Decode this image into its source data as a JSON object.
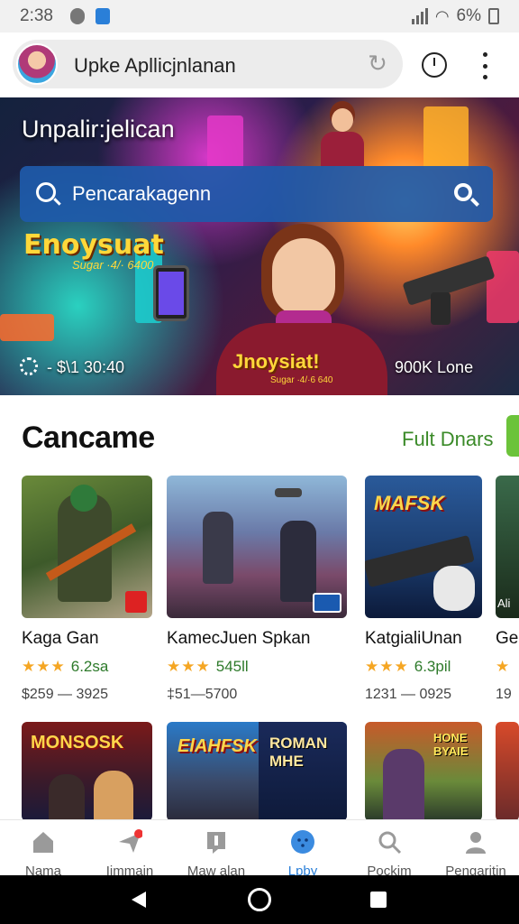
{
  "status_bar": {
    "time": "2:38",
    "battery": "6%"
  },
  "browser": {
    "url_text": "Upke Apllicjnlanan"
  },
  "hero": {
    "title": "Unpalir:jelican",
    "search_placeholder": "Pencarakagenn",
    "game_name": "Enoysuat",
    "game_sub": "Sugar ·4/· 6400",
    "meta_left": "- $\\1 30:40",
    "logo_text": "Jnoysiat!",
    "logo_sub": "Sugar ·4/·6 640",
    "meta_right": "900K Lone"
  },
  "section": {
    "title": "Cancame",
    "link": "Fult Dnars"
  },
  "cards": [
    {
      "title": "Kaga Gan",
      "rating": "6.2sa",
      "stars": 3,
      "price": "$259 — 3925",
      "badge": ""
    },
    {
      "title": "KamecJuen Spkan",
      "rating": "545ll",
      "stars": 3,
      "price": "‡51—5700",
      "badge": ""
    },
    {
      "title": "KatgialiUnan",
      "rating": "6.3pil",
      "stars": 3,
      "price": "1231 — 0925",
      "badge": "MAFSK"
    },
    {
      "title": "Ge",
      "rating": "",
      "stars": 1,
      "price": "19",
      "badge": "Ali"
    }
  ],
  "cards_row2": [
    {
      "badge": "MONSOSK"
    },
    {
      "badge": "ElAHFSK"
    },
    {
      "badge": "ROMAN MHE"
    },
    {
      "badge": "HONE BYAIE"
    }
  ],
  "bottom_nav": [
    {
      "label": "Nama",
      "icon": "home-icon"
    },
    {
      "label": "Ijmmain",
      "icon": "send-icon"
    },
    {
      "label": "Maw alan",
      "icon": "bookmark-icon"
    },
    {
      "label": "Lpby",
      "icon": "face-icon"
    },
    {
      "label": "Pockim",
      "icon": "search-icon"
    },
    {
      "label": "Pengaritin",
      "icon": "person-icon"
    }
  ],
  "colors": {
    "accent": "#2a7fd8",
    "green": "#3a8a28",
    "star": "#f5a623"
  }
}
